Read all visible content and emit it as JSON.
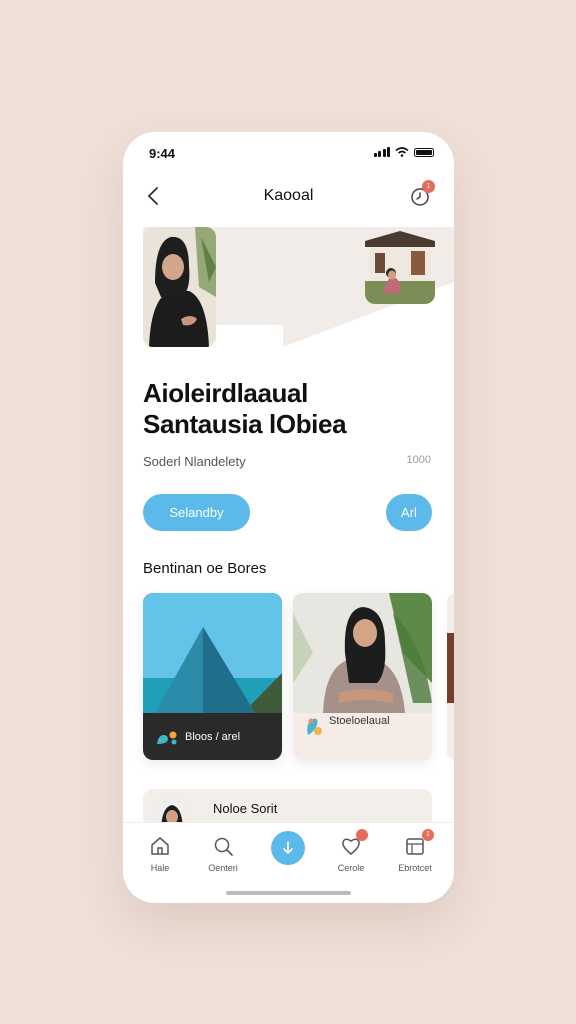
{
  "status": {
    "time": "9:44"
  },
  "nav": {
    "title": "Kaooal",
    "notification_count": "1"
  },
  "article": {
    "headline_line1": "Aioleirdlaaual",
    "headline_line2": "Santausia lObiea",
    "meta_left": "Soderl Nlandelety",
    "meta_right": "1000"
  },
  "buttons": {
    "primary": "Selandby",
    "secondary": "Arl"
  },
  "section": {
    "title": "Bentinan oe Bores"
  },
  "cards": [
    {
      "label": "Bloos / arel"
    },
    {
      "label": "Stoeloelaual"
    }
  ],
  "list": {
    "item_label": "Noloe Sorit"
  },
  "tabs": {
    "home": "Hale",
    "search": "Oenteri",
    "favorites": "Cerole",
    "profile": "Ebrotcet",
    "favorites_badge": "",
    "profile_badge": "1"
  },
  "colors": {
    "accent": "#5bbaea",
    "badge": "#e66b5b",
    "background": "#efe0d8"
  }
}
